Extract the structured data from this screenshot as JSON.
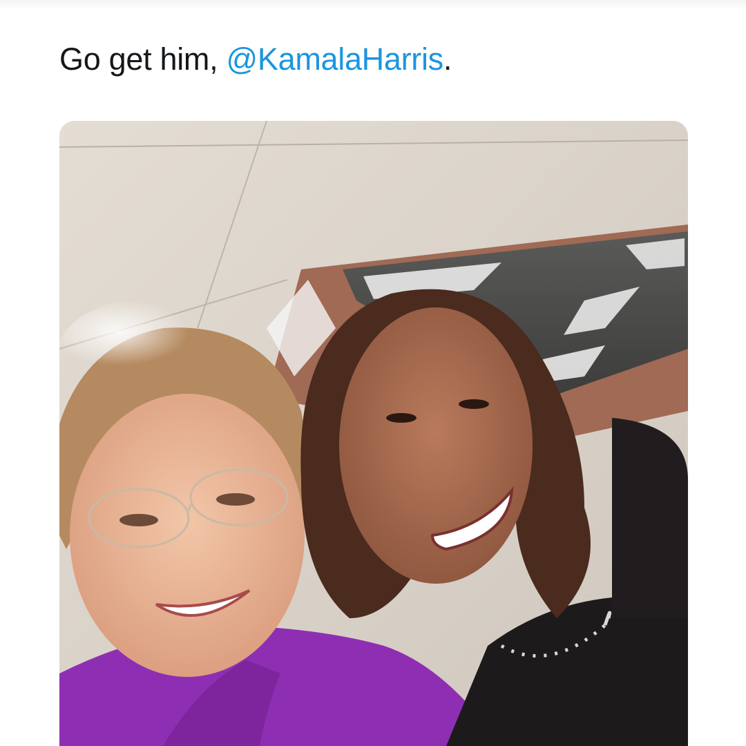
{
  "tweet": {
    "text_prefix": "Go get him, ",
    "mention": "@KamalaHarris",
    "text_suffix": "."
  },
  "colors": {
    "mention": "#1b95e0",
    "text": "#14171a",
    "background": "#ffffff",
    "jacket": "#8e2fb3"
  }
}
